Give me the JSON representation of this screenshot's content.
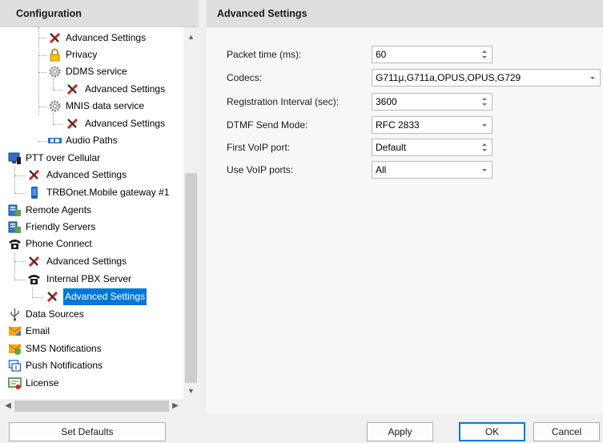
{
  "left_panel": {
    "title": "Configuration"
  },
  "right_panel": {
    "title": "Advanced Settings"
  },
  "tree": [
    {
      "label": "Advanced Settings",
      "icon": "tools-icon"
    },
    {
      "label": "Privacy",
      "icon": "lock-icon"
    },
    {
      "label": "DDMS service",
      "icon": "gear-icon"
    },
    {
      "label": "Advanced Settings",
      "icon": "tools-icon"
    },
    {
      "label": "MNIS data service",
      "icon": "gear-icon"
    },
    {
      "label": "Advanced Settings",
      "icon": "tools-icon"
    },
    {
      "label": "Audio Paths",
      "icon": "audio-paths-icon"
    },
    {
      "label": "PTT over Cellular",
      "icon": "ptt-cellular-icon"
    },
    {
      "label": "Advanced Settings",
      "icon": "tools-icon"
    },
    {
      "label": "TRBOnet.Mobile gateway #1",
      "icon": "mobile-phone-icon"
    },
    {
      "label": "Remote Agents",
      "icon": "server-icon"
    },
    {
      "label": "Friendly Servers",
      "icon": "server-icon"
    },
    {
      "label": "Phone Connect",
      "icon": "telephone-icon"
    },
    {
      "label": "Advanced Settings",
      "icon": "tools-icon"
    },
    {
      "label": "Internal PBX Server",
      "icon": "telephone-icon"
    },
    {
      "label": "Advanced Settings",
      "icon": "tools-icon",
      "selected": true
    },
    {
      "label": "Data Sources",
      "icon": "usb-icon"
    },
    {
      "label": "Email",
      "icon": "envelope-icon"
    },
    {
      "label": "SMS Notifications",
      "icon": "sms-icon"
    },
    {
      "label": "Push Notifications",
      "icon": "push-notification-icon"
    },
    {
      "label": "License",
      "icon": "license-icon"
    }
  ],
  "form": {
    "packet_time": {
      "label": "Packet time (ms):",
      "value": "60"
    },
    "codecs": {
      "label": "Codecs:",
      "value": "G711μ,G711a,OPUS,OPUS,G729"
    },
    "registration_interval": {
      "label": "Registration Interval (sec):",
      "value": "3600"
    },
    "dtmf_mode": {
      "label": "DTMF Send Mode:",
      "value": "RFC 2833"
    },
    "first_voip_port": {
      "label": "First VoIP port:",
      "value": "Default"
    },
    "use_voip_ports": {
      "label": "Use VoIP ports:",
      "value": "All"
    }
  },
  "buttons": {
    "set_defaults": "Set Defaults",
    "apply": "Apply",
    "ok": "OK",
    "cancel": "Cancel"
  },
  "colors": {
    "selection": "#0078d7",
    "header_bg": "#dedede"
  }
}
